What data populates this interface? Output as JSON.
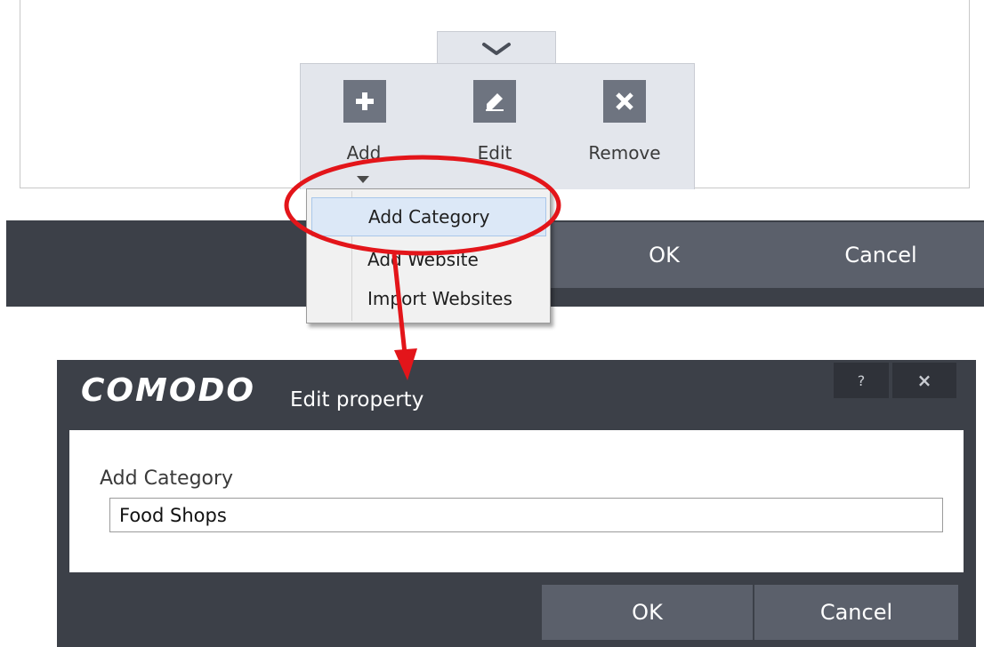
{
  "toolbar": {
    "add_label": "Add",
    "edit_label": "Edit",
    "remove_label": "Remove"
  },
  "add_menu": {
    "items": [
      {
        "label": "Add Category"
      },
      {
        "label": "Add Website"
      },
      {
        "label": "Import Websites"
      }
    ]
  },
  "main_bar": {
    "ok_label": "OK",
    "cancel_label": "Cancel"
  },
  "dialog": {
    "logo_text": "COMODO",
    "title": "Edit property",
    "help_label": "?",
    "close_label": "×",
    "field_label": "Add Category",
    "field_value": "Food Shops",
    "ok_label": "OK",
    "cancel_label": "Cancel"
  },
  "icons": {
    "collapse": "chevron-down-icon",
    "add": "plus-icon",
    "edit": "pencil-icon",
    "remove": "x-icon",
    "add_dropdown": "caret-down-icon"
  },
  "colors": {
    "dark_panel": "#3c4048",
    "dark_button": "#5b606b",
    "toolbar_bg": "#e3e6ec",
    "icon_bg": "#6e7480",
    "highlight": "#dce8f7",
    "annotation": "#e3151a"
  }
}
